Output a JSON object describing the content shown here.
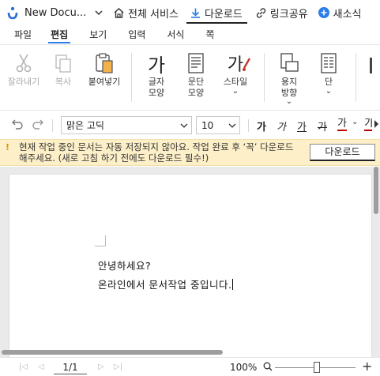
{
  "topbar": {
    "doc_title": "New Docu...",
    "actions": [
      {
        "icon": "home-icon",
        "label": "전체 서비스"
      },
      {
        "icon": "download-icon",
        "label": "다운로드"
      },
      {
        "icon": "link-icon",
        "label": "링크공유"
      },
      {
        "icon": "plus-circle-icon",
        "label": "새소식"
      }
    ]
  },
  "menu": {
    "tabs": [
      "파일",
      "편집",
      "보기",
      "입력",
      "서식",
      "쪽"
    ],
    "active": "편집"
  },
  "ribbon": {
    "cut": "잘라내기",
    "copy": "복사",
    "paste": "붙여넣기",
    "font_shape_line1": "글자",
    "font_shape_line2": "모양",
    "para_shape_line1": "문단",
    "para_shape_line2": "모양",
    "style_label": "스타일",
    "style_glyph": "가",
    "font_glyph": "가",
    "page_dir_line1": "용지",
    "page_dir_line2": "방향",
    "columns_label": "단"
  },
  "format": {
    "font_name": "맑은 고딕",
    "font_size": "10",
    "bold_glyph": "가",
    "italic_glyph": "가",
    "underline_glyph": "가",
    "strike_glyph": "가",
    "color_glyph": "가",
    "highlight_glyph": "가",
    "accent_red": "#c00000"
  },
  "notice": {
    "icon": "!",
    "text": "현재 작업 중인 문서는 자동 저장되지 않아요. 작업 완료 후 ‘꼭’ 다운로드 해주세요. (새로 고침 하기 전에도 다운로드 필수!)",
    "button": "다운로드",
    "bg_color": "#fdefc8"
  },
  "document": {
    "lines": [
      "안녕하세요?",
      "온라인에서 문서작업 중입니다."
    ]
  },
  "status": {
    "page": "1/1",
    "zoom": "100%",
    "zoom_level_percent": 100
  }
}
